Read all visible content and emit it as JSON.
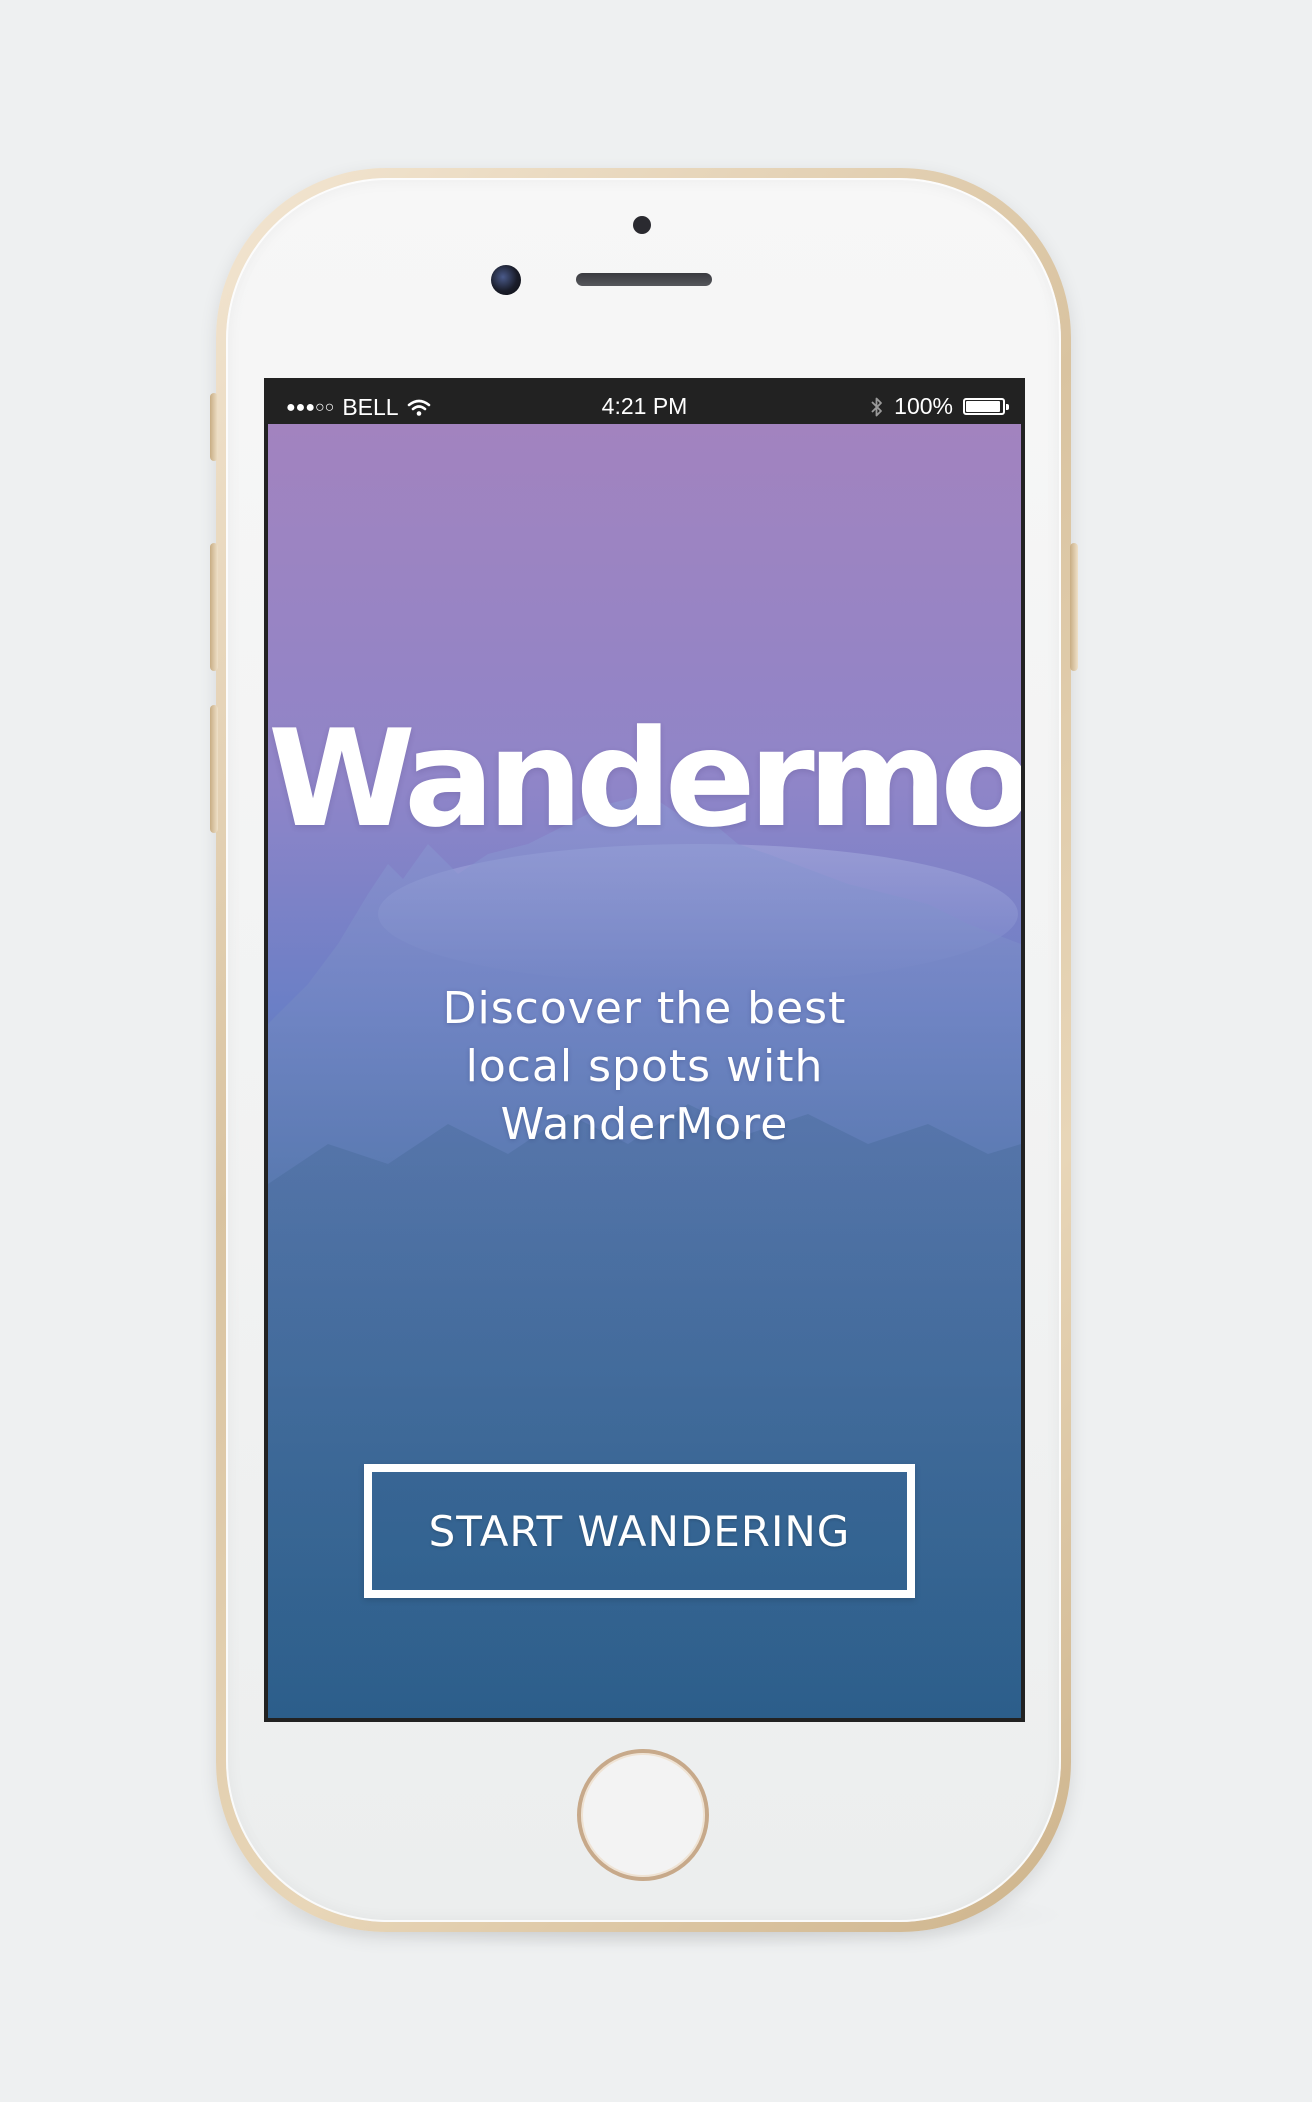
{
  "status_bar": {
    "carrier": "BELL",
    "time": "4:21 PM",
    "battery": "100%",
    "signal_icon": "signal-dots-icon",
    "wifi_icon": "wifi-icon",
    "bluetooth_icon": "bluetooth-icon",
    "battery_icon": "battery-icon",
    "battery_level": 1.0
  },
  "app": {
    "logo": "Wandermore",
    "tagline_lines": [
      "Discover the best",
      "local spots with",
      "WanderMore"
    ],
    "cta_label": "START WANDERING"
  },
  "colors": {
    "gradient_top": "#a283bf",
    "gradient_bottom": "#2b5f8c",
    "phone_frame": "#d9c3a0",
    "status_bar_bg": "#222222"
  }
}
